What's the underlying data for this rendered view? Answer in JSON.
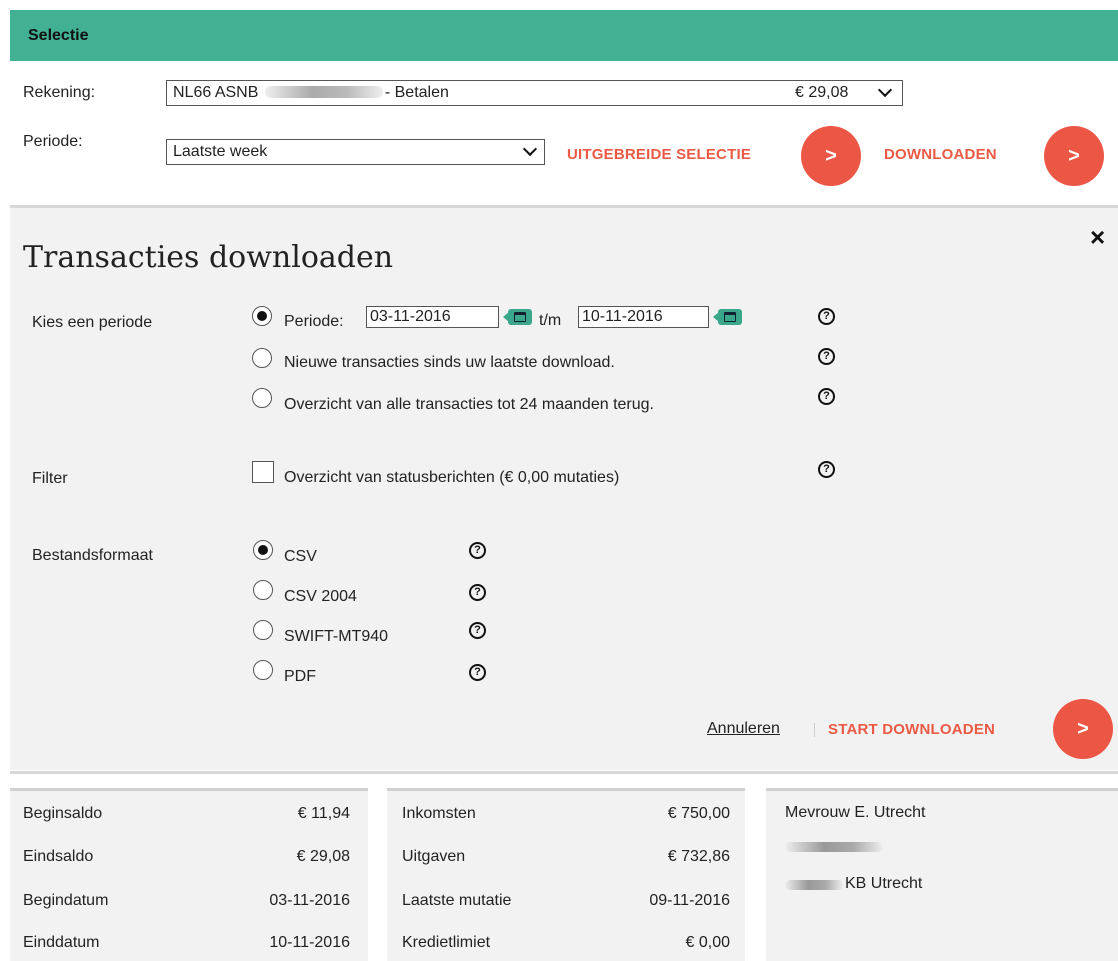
{
  "header": {
    "title": "Selectie"
  },
  "account": {
    "label": "Rekening:",
    "iban_prefix": "NL66 ASNB",
    "account_suffix": "- Betalen",
    "balance": "€ 29,08"
  },
  "period": {
    "label": "Periode:",
    "selected": "Laatste week"
  },
  "actions": {
    "extended_selection": "UITGEBREIDE SELECTIE",
    "download": "DOWNLOADEN",
    "arrow": ">"
  },
  "download_panel": {
    "title": "Transacties downloaden",
    "close": "×",
    "period_section": {
      "label": "Kies een periode",
      "option_period": "Periode:",
      "from_date": "03-11-2016",
      "to_sep": "t/m",
      "to_date": "10-11-2016",
      "option_new": "Nieuwe transacties sinds uw laatste download.",
      "option_all": "Overzicht van alle transacties tot 24 maanden terug."
    },
    "filter_section": {
      "label": "Filter",
      "option_status": "Overzicht van statusberichten (€ 0,00 mutaties)"
    },
    "format_section": {
      "label": "Bestandsformaat",
      "options": [
        "CSV",
        "CSV 2004",
        "SWIFT-MT940",
        "PDF"
      ]
    },
    "help": "?",
    "cancel": "Annuleren",
    "start": "START DOWNLOADEN"
  },
  "summary": {
    "balances": [
      {
        "label": "Beginsaldo",
        "value": "€ 11,94"
      },
      {
        "label": "Eindsaldo",
        "value": "€ 29,08"
      },
      {
        "label": "Begindatum",
        "value": "03-11-2016"
      },
      {
        "label": "Einddatum",
        "value": "10-11-2016"
      }
    ],
    "flows": [
      {
        "label": "Inkomsten",
        "value": "€ 750,00"
      },
      {
        "label": "Uitgaven",
        "value": "€ 732,86"
      },
      {
        "label": "Laatste mutatie",
        "value": "09-11-2016"
      },
      {
        "label": "Kredietlimiet",
        "value": "€ 0,00"
      }
    ],
    "holder": {
      "name": "Mevrouw E. Utrecht",
      "city_suffix": "KB Utrecht"
    }
  },
  "colors": {
    "brand_green": "#42b092",
    "accent_red": "#ec5745",
    "panel_bg": "#f2f2f2"
  },
  "selected_state": {
    "period_option": "period",
    "format": "CSV",
    "status_filter": false
  }
}
